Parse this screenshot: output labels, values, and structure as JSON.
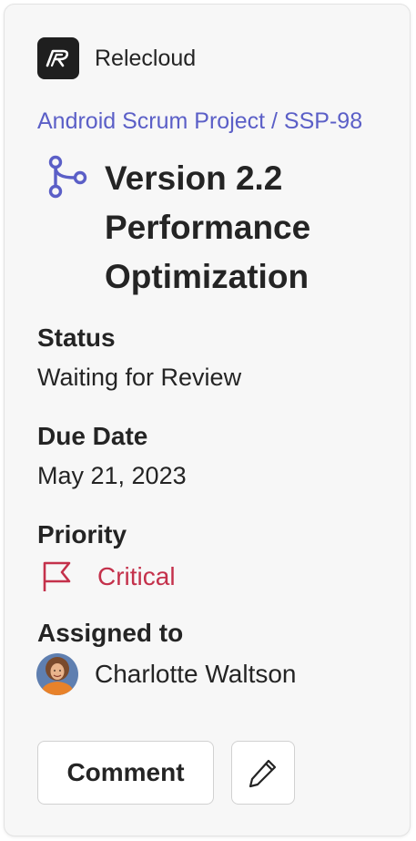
{
  "brand": {
    "name": "Relecloud",
    "logo_icon": "relecloud-logo-icon"
  },
  "breadcrumb": "Android Scrum Project / SSP-98",
  "title": "Version 2.2 Performance Optimization",
  "title_icon": "branch-icon",
  "fields": {
    "status": {
      "label": "Status",
      "value": "Waiting for Review"
    },
    "due_date": {
      "label": "Due Date",
      "value": "May 21, 2023"
    },
    "priority": {
      "label": "Priority",
      "value": "Critical",
      "icon": "flag-icon",
      "color": "#c4314b"
    },
    "assigned_to": {
      "label": "Assigned to",
      "value": "Charlotte Waltson",
      "icon": "avatar"
    }
  },
  "actions": {
    "comment_label": "Comment",
    "edit_icon": "pencil-icon"
  },
  "colors": {
    "accent": "#5b5fc7",
    "critical": "#c4314b",
    "text": "#242424",
    "card_bg": "#f7f7f7"
  }
}
